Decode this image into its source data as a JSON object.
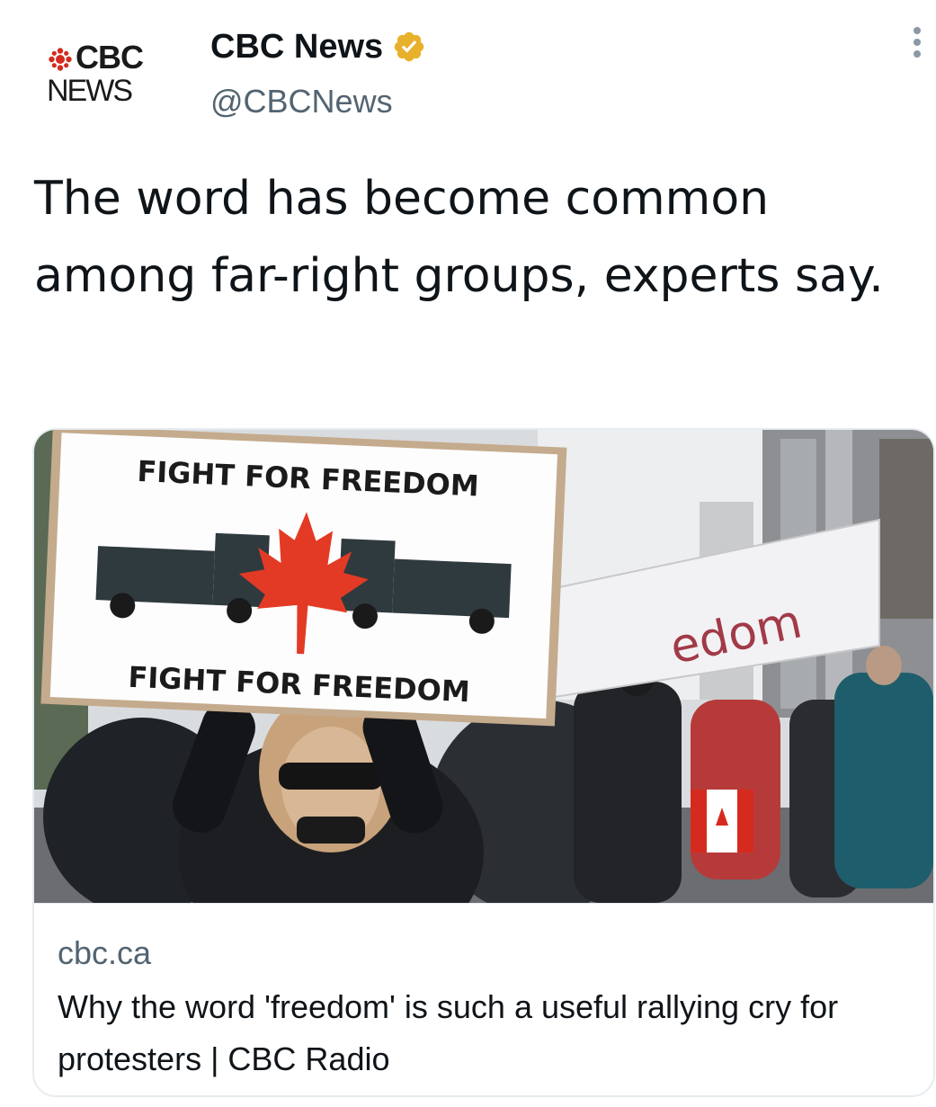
{
  "author": {
    "display_name": "CBC News",
    "handle": "@CBCNews",
    "verified": true,
    "avatar": {
      "logo_line1": "CBC",
      "logo_line2": "NEWS"
    }
  },
  "menu_icon": "more-vertical-icon",
  "tweet": {
    "text": "The word has become common among far-right groups, experts say."
  },
  "card": {
    "image": {
      "sign_text_top": "FIGHT FOR FREEDOM",
      "sign_text_bottom": "FIGHT FOR FREEDOM",
      "banner_text": "edom"
    },
    "domain": "cbc.ca",
    "title": "Why the word 'freedom' is such a useful rallying cry for protesters | CBC Radio"
  },
  "colors": {
    "verified_badge": "#e8b12c",
    "cbc_red": "#d52b1e",
    "secondary_text": "#536471"
  }
}
